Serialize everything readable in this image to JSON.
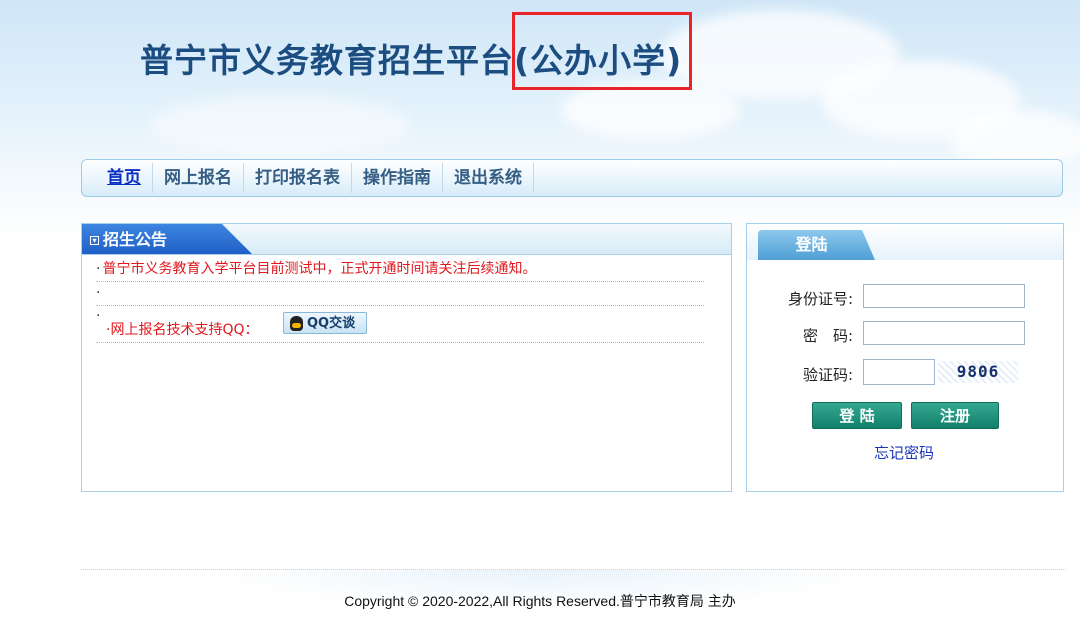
{
  "header": {
    "title": "普宁市义务教育招生平台(公办小学)"
  },
  "nav": {
    "items": [
      "首页",
      "网上报名",
      "打印报名表",
      "操作指南",
      "退出系统"
    ]
  },
  "notice": {
    "tab_title": "招生公告",
    "rows": [
      "普宁市义务教育入学平台目前测试中，正式开通时间请关注后续通知。",
      "",
      "·网上报名技术支持QQ："
    ],
    "qq_button": "QQ交谈"
  },
  "login": {
    "tab_title": "登陆",
    "id_label": "身份证号:",
    "password_label": "密　码:",
    "captcha_label": "验证码:",
    "captcha_code": "9806",
    "login_button": "登 陆",
    "register_button": "注册",
    "forgot_link": "忘记密码"
  },
  "footer": {
    "copyright": "Copyright © 2020-2022,All Rights Reserved.普宁市教育局 主办"
  },
  "colors": {
    "title": "#1c4d80",
    "highlight_box": "#e8242a",
    "notice_text": "#e0181e",
    "button_green": "#12806b",
    "link_blue": "#1a35b8"
  }
}
